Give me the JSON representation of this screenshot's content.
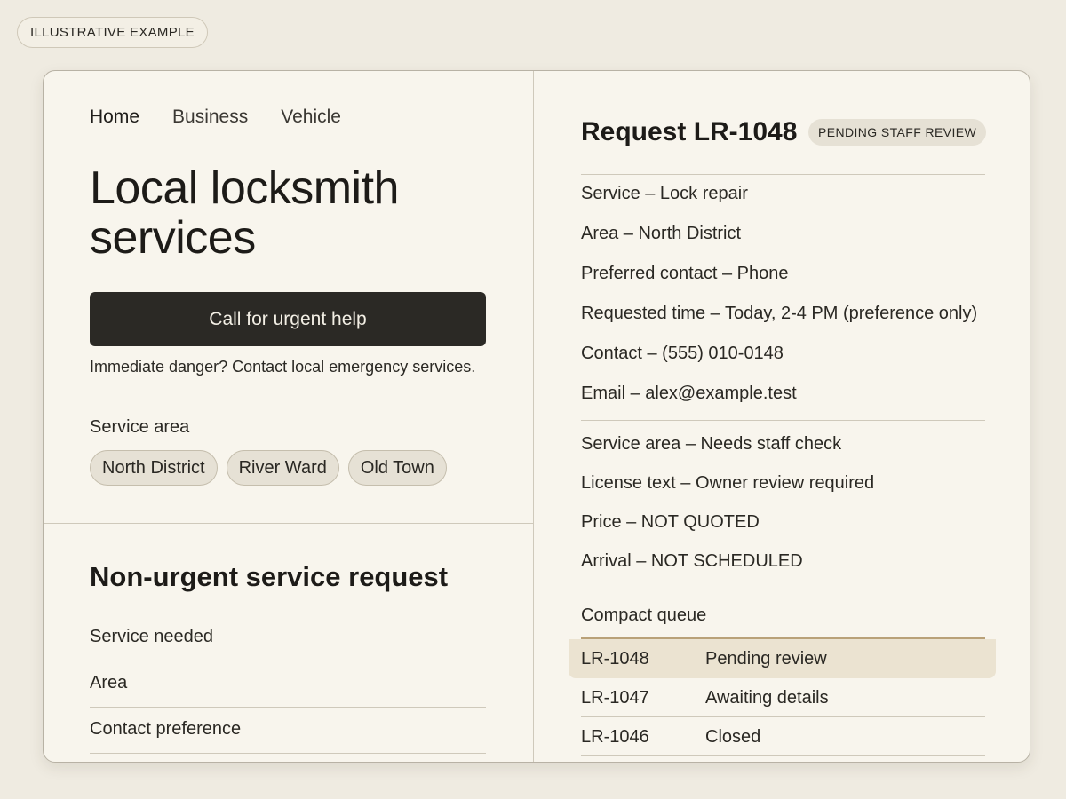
{
  "illustrative_tag": "ILLUSTRATIVE EXAMPLE",
  "nav": [
    "Home",
    "Business",
    "Vehicle"
  ],
  "hero": {
    "title": "Local locksmith services",
    "cta_label": "Call for urgent help",
    "danger_note": "Immediate danger? Contact local emergency services."
  },
  "service_area": {
    "label": "Service area",
    "chips": [
      "North District",
      "River Ward",
      "Old Town"
    ]
  },
  "form": {
    "title": "Non-urgent service request",
    "fields": [
      "Service needed",
      "Area",
      "Contact preference"
    ]
  },
  "request": {
    "title": "Request LR-1048",
    "badge": "PENDING STAFF REVIEW",
    "details": [
      "Service – Lock repair",
      "Area – North District",
      "Preferred contact – Phone",
      "Requested time – Today, 2-4 PM (preference only)",
      "Contact – (555) 010-0148",
      "Email – alex@example.test"
    ],
    "checks": [
      "Service area – Needs staff check",
      "License text – Owner review required",
      "Price – NOT QUOTED",
      "Arrival – NOT SCHEDULED"
    ]
  },
  "queue": {
    "label": "Compact queue",
    "rows": [
      {
        "id": "LR-1048",
        "status": "Pending review"
      },
      {
        "id": "LR-1047",
        "status": "Awaiting details"
      },
      {
        "id": "LR-1046",
        "status": "Closed"
      }
    ]
  }
}
